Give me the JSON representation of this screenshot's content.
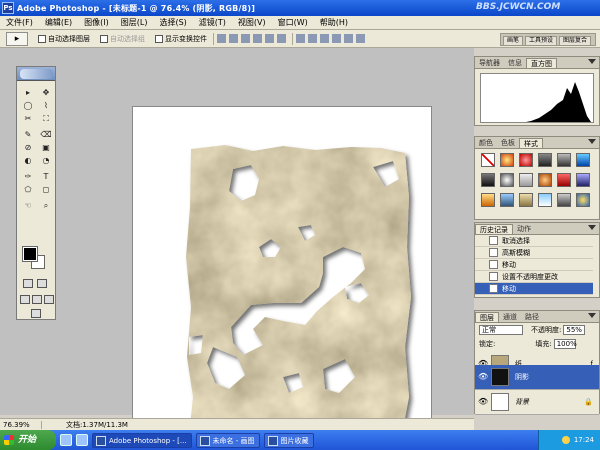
{
  "window": {
    "app_icon": "Ps",
    "title": "Adobe Photoshop - [未标题-1 @ 76.4% (阴影, RGB/8)]",
    "watermark": "BBS.JCWCN.COM"
  },
  "menu": [
    "文件(F)",
    "编辑(E)",
    "图像(I)",
    "图层(L)",
    "选择(S)",
    "滤镜(T)",
    "视图(V)",
    "窗口(W)",
    "帮助(H)"
  ],
  "options": {
    "tool_glyph": "▸",
    "auto_select": "自动选择图层",
    "auto_group": "自动选择组",
    "show_transform": "显示变换控件",
    "dock_tabs": [
      "画笔",
      "工具预设",
      "图层复合"
    ]
  },
  "toolbox": {
    "tools": [
      "▸",
      "✥",
      "◯",
      "⌇",
      "✂",
      "⛶",
      "✎",
      "⌫",
      "⊘",
      "▣",
      "◐",
      "◔",
      "✑",
      "T",
      "⬠",
      "◻",
      "☜",
      "⌕"
    ]
  },
  "panels": {
    "navigator_tabs": [
      "导航器",
      "信息",
      "直方图"
    ],
    "styles_tabs": [
      "颜色",
      "色板",
      "样式"
    ],
    "history_tabs": [
      "历史记录",
      "动作"
    ],
    "history_items": [
      "取消选择",
      "高斯模糊",
      "移动",
      "设置不透明度更改",
      "移动"
    ],
    "layers_tabs": [
      "图层",
      "通道",
      "路径"
    ],
    "blend_mode": "正常",
    "opacity_label": "不透明度:",
    "opacity_value": "55%",
    "lock_label": "锁定:",
    "fill_label": "填充:",
    "fill_value": "100%",
    "layers": [
      {
        "name": "纸",
        "fx": "ƒ"
      },
      {
        "name": "阴影"
      },
      {
        "name": "背景",
        "lock": "🔒"
      }
    ]
  },
  "status": {
    "zoom": "76.39%",
    "doc": "文档:1.37M/11.3M"
  },
  "taskbar": {
    "start": "开始",
    "tasks": [
      "Adobe Photoshop - [...",
      "未命名 - 画图",
      "图片收藏"
    ],
    "clock": "17:24"
  },
  "colors": {
    "paper_light": "#c9b98c",
    "paper_dark": "#8a7a4e",
    "selection": "#3660b8",
    "xp_blue": "#245edb"
  }
}
